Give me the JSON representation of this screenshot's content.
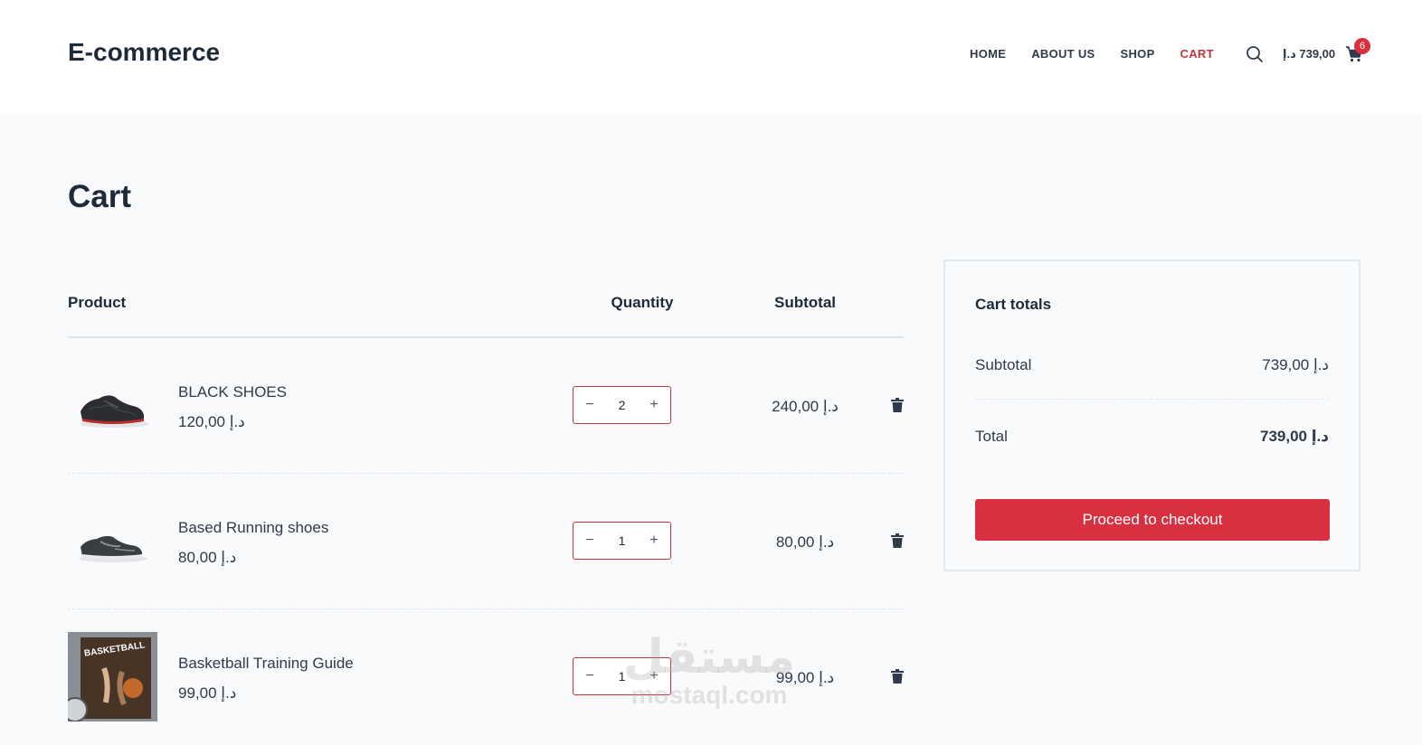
{
  "header": {
    "logo": "E-commerce",
    "nav": [
      {
        "label": "HOME",
        "active": false
      },
      {
        "label": "ABOUT US",
        "active": false
      },
      {
        "label": "SHOP",
        "active": false
      },
      {
        "label": "CART",
        "active": true
      }
    ],
    "search_icon": "search-icon",
    "cart_total": "739,00 د.إ",
    "cart_icon": "shopping-cart-icon",
    "cart_count": "6"
  },
  "page": {
    "title": "Cart"
  },
  "cart_table": {
    "headers": {
      "product": "Product",
      "quantity": "Quantity",
      "subtotal": "Subtotal"
    },
    "minus_symbol": "−",
    "plus_symbol": "+",
    "rows": [
      {
        "name": "BLACK SHOES",
        "price": "د.إ 120,00",
        "quantity": "2",
        "subtotal": "د.إ 240,00",
        "image": "black-shoes-image"
      },
      {
        "name": "Based Running shoes",
        "price": "د.إ 80,00",
        "quantity": "1",
        "subtotal": "د.إ 80,00",
        "image": "running-shoes-image"
      },
      {
        "name": "Basketball Training Guide",
        "price": "د.إ 99,00",
        "quantity": "1",
        "subtotal": "د.إ 99,00",
        "image": "basketball-book-image",
        "image_text": "BASKETBALL"
      }
    ]
  },
  "totals": {
    "title": "Cart totals",
    "subtotal_label": "Subtotal",
    "subtotal_value": "د.إ 739,00",
    "total_label": "Total",
    "total_value": "د.إ 739,00",
    "checkout_label": "Proceed to checkout"
  },
  "watermark": {
    "arabic": "مستقل",
    "latin": "mostaql.com"
  },
  "colors": {
    "accent": "#d7303f",
    "nav_active": "#c0343c",
    "text": "#1e2a38",
    "background": "#f9fafb"
  }
}
